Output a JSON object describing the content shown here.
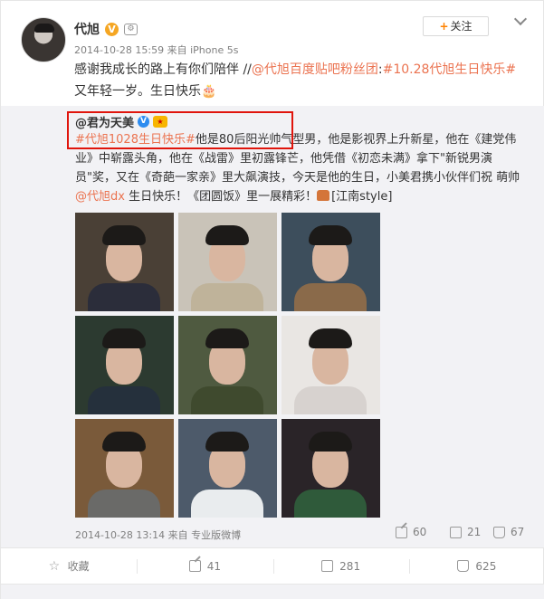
{
  "post": {
    "author": "代旭",
    "badge_v": "V",
    "level": "⚙",
    "time": "2014-10-28 15:59",
    "via": "来自 iPhone 5s",
    "follow_label": "关注",
    "text_prefix": "感谢我成长的路上有你们陪伴 //",
    "mention": "@代旭百度贴吧粉丝团",
    "colon": ":",
    "hashtag": "#10.28代旭生日快乐#",
    "text_suffix": "又年轻一岁。生日快乐",
    "cake_emoji": "🎂"
  },
  "repost": {
    "author": "@君为天美",
    "hashtag": "#代旭1028生日快乐#",
    "text1": "他是80后阳光帅气型男，他是影视界上升新星，他在《建党伟业》中崭露头角，他在《战雷》里初露锋芒，他凭借《初恋未满》拿下\"新锐男演员\"奖，又在《奇葩一家亲》里大飙演技，今天是他的生日，小美君携小伙伴们祝 萌帅 ",
    "mention": "@代旭dx",
    "text2": " 生日快乐！《团圆饭》里一展精彩！",
    "tag": "[江南style]",
    "time": "2014-10-28 13:14",
    "via": "来自 专业版微博",
    "reposts": "60",
    "comments": "21",
    "likes": "67"
  },
  "photos": [
    {
      "bg": "#4a4036",
      "shirt": "#2b2d3a"
    },
    {
      "bg": "#c9c3b8",
      "shirt": "#bfb39a"
    },
    {
      "bg": "#3d4e5c",
      "shirt": "#8a6a4a"
    },
    {
      "bg": "#2c3a30",
      "shirt": "#25303c"
    },
    {
      "bg": "#4f5a40",
      "shirt": "#3f4a2e"
    },
    {
      "bg": "#e9e6e3",
      "shirt": "#d7d2cf"
    },
    {
      "bg": "#7a5a3a",
      "shirt": "#6a6a68"
    },
    {
      "bg": "#4d5a6a",
      "shirt": "#e9ecee"
    },
    {
      "bg": "#2a2428",
      "shirt": "#2f5a3a"
    }
  ],
  "footer": {
    "collect": "收藏",
    "repost": "41",
    "comment": "281",
    "like": "625"
  }
}
